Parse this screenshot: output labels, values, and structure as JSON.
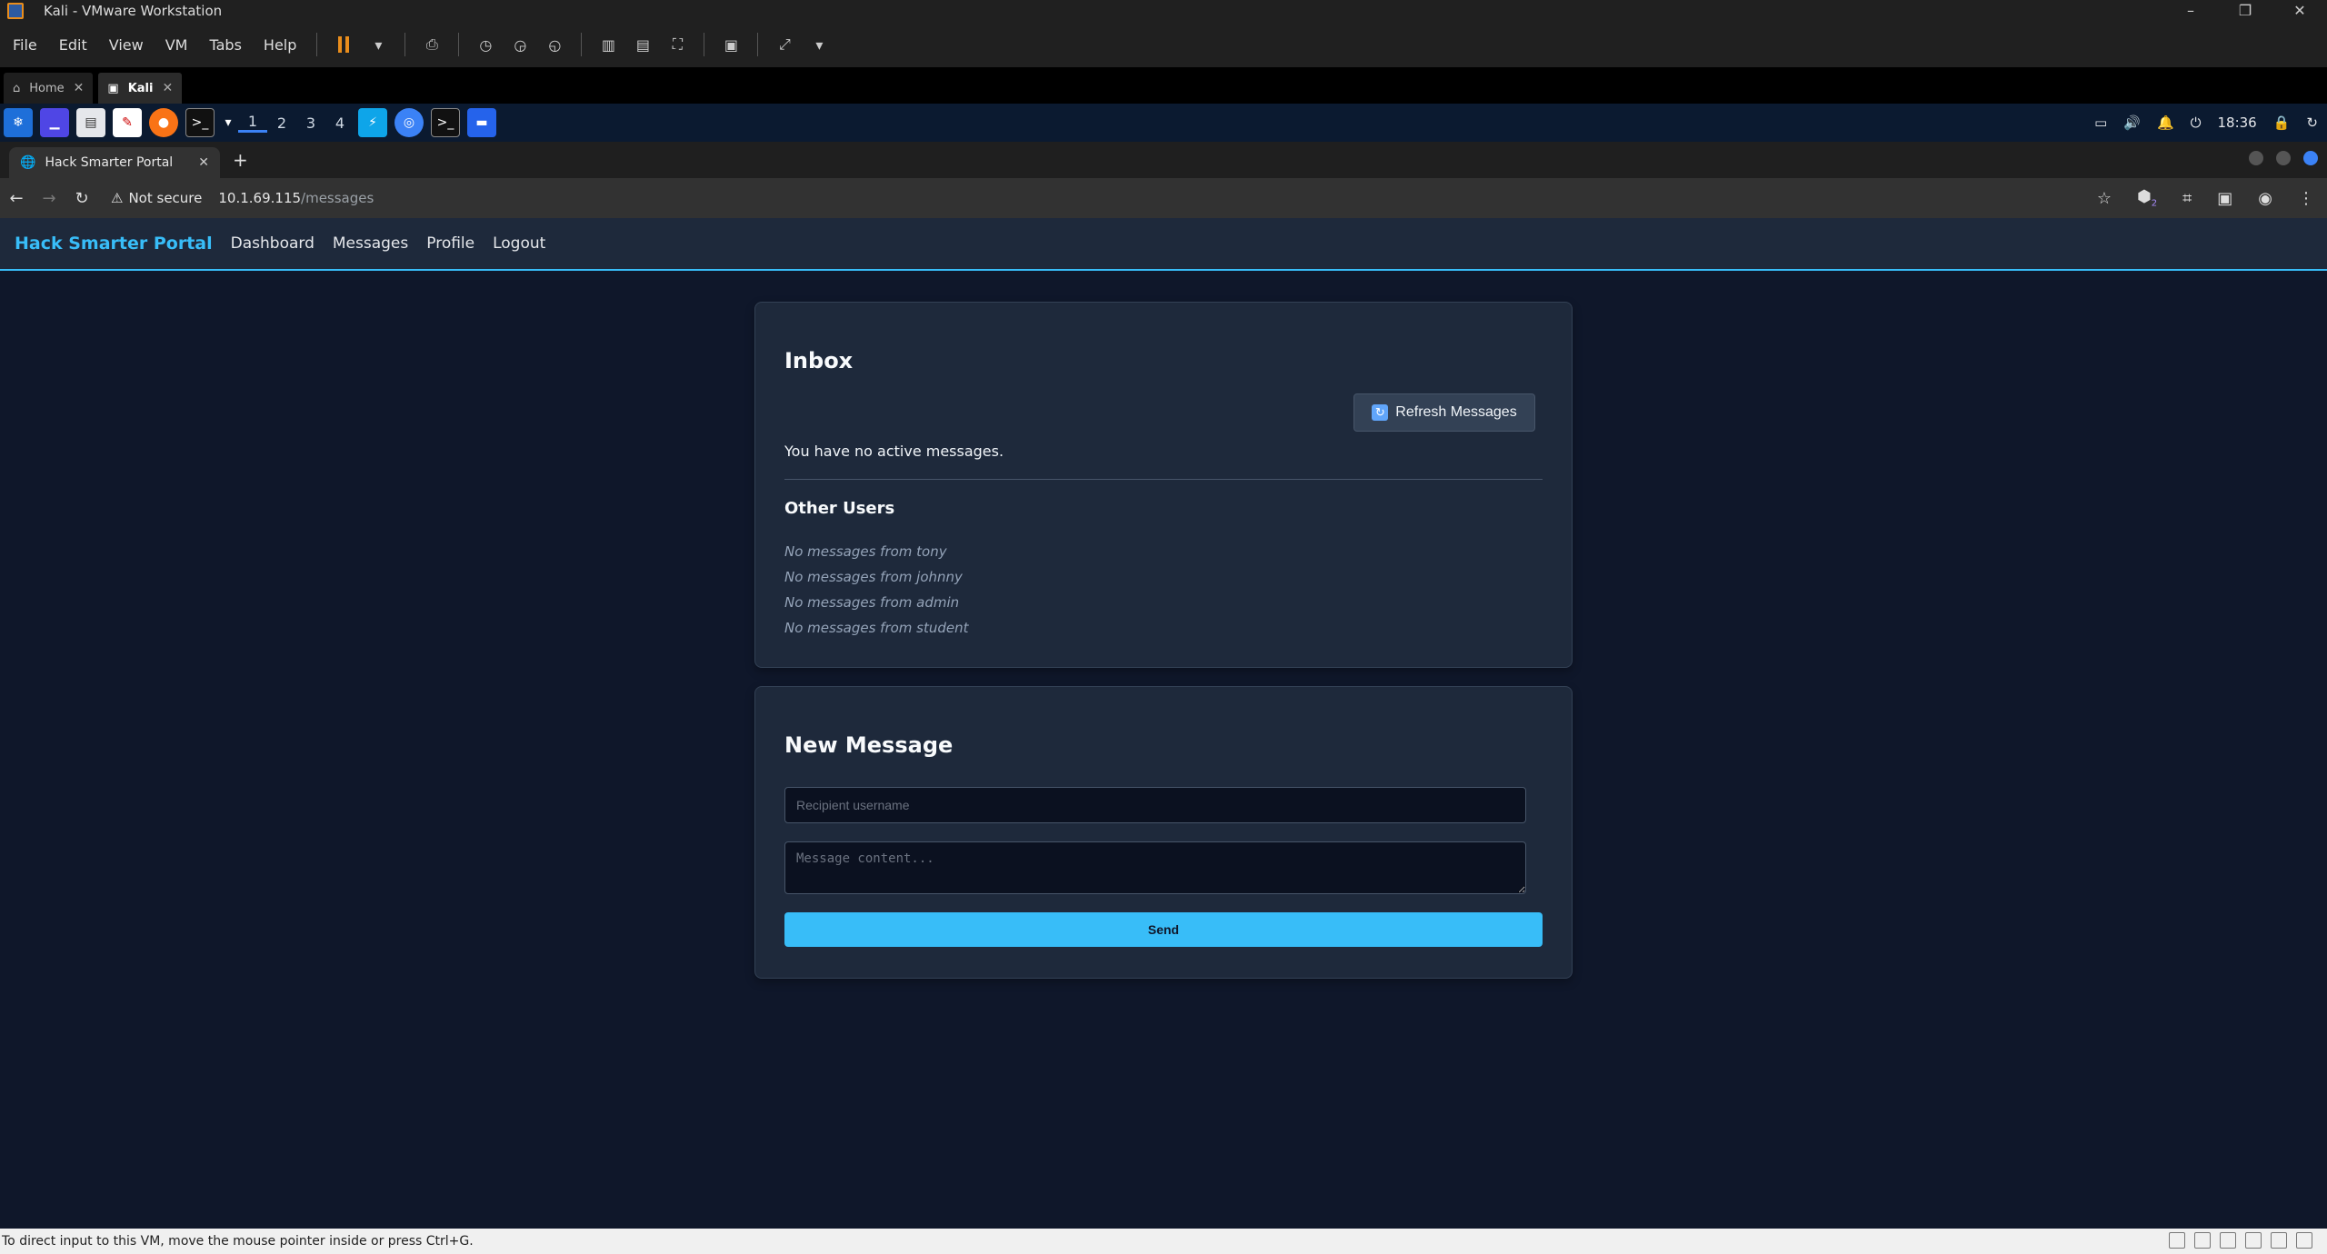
{
  "vmware": {
    "title": "Kali - VMware Workstation",
    "menu": [
      "File",
      "Edit",
      "View",
      "VM",
      "Tabs",
      "Help"
    ],
    "tabs": [
      {
        "label": "Home"
      },
      {
        "label": "Kali"
      }
    ],
    "status_text": "To direct input to this VM, move the mouse pointer inside or press Ctrl+G."
  },
  "kali": {
    "workspaces": [
      "1",
      "2",
      "3",
      "4"
    ],
    "clock": "18:36"
  },
  "browser": {
    "tab_title": "Hack Smarter Portal",
    "security_label": "Not secure",
    "url_host": "10.1.69.115",
    "url_path": "/messages",
    "extension_badge": "2"
  },
  "site": {
    "brand": "Hack Smarter Portal",
    "nav": [
      "Dashboard",
      "Messages",
      "Profile",
      "Logout"
    ]
  },
  "inbox": {
    "title": "Inbox",
    "refresh_label": "Refresh Messages",
    "empty_text": "You have no active messages.",
    "other_users_title": "Other Users",
    "other_users": [
      "No messages from tony",
      "No messages from johnny",
      "No messages from admin",
      "No messages from student"
    ]
  },
  "new_message": {
    "title": "New Message",
    "recipient_placeholder": "Recipient username",
    "message_placeholder": "Message content...",
    "send_label": "Send"
  }
}
